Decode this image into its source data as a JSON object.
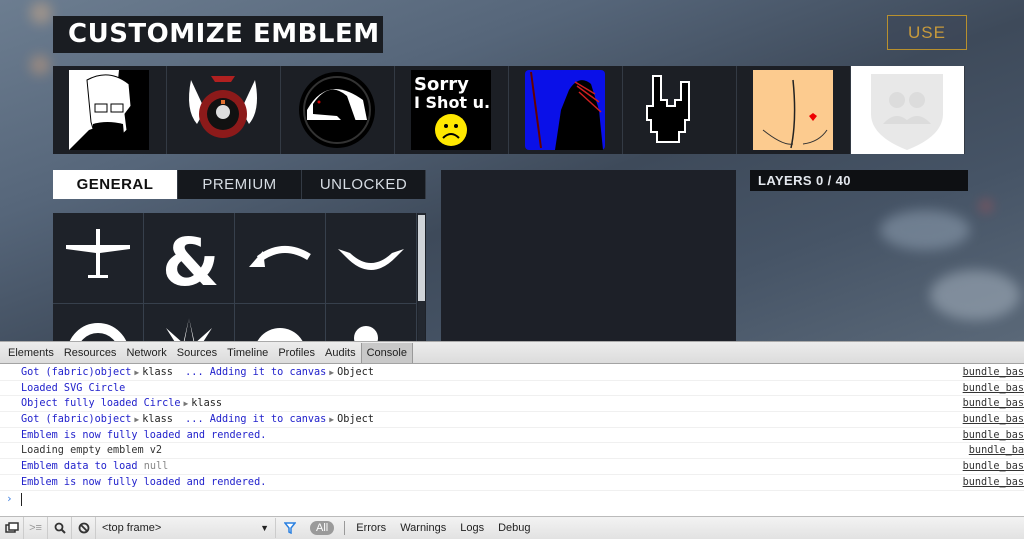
{
  "page": {
    "title": "CUSTOMIZE EMBLEM",
    "use_button": "USE",
    "accent_color": "#c79a3c"
  },
  "emblems": [
    {
      "name": "heisenberg-emblem",
      "selected": false
    },
    {
      "name": "winged-skull-emblem",
      "selected": false
    },
    {
      "name": "raven-emblem",
      "selected": false
    },
    {
      "name": "sorry-i-shot-u-emblem",
      "text_line1": "Sorry",
      "text_line2": "I Shot u.",
      "selected": false
    },
    {
      "name": "tribal-warrior-emblem",
      "selected": false
    },
    {
      "name": "rock-hand-emblem",
      "selected": false
    },
    {
      "name": "heart-butt-emblem",
      "selected": false
    },
    {
      "name": "empty-squad-emblem",
      "selected": true
    }
  ],
  "tabs": [
    {
      "label": "GENERAL",
      "active": true
    },
    {
      "label": "PREMIUM",
      "active": false
    },
    {
      "label": "UNLOCKED",
      "active": false
    }
  ],
  "shapes": [
    "airplane",
    "ampersand",
    "curved-arrow",
    "banner-ribbon",
    "lifebuoy",
    "starburst",
    "half-circle",
    "dot"
  ],
  "layers": {
    "label": "LAYERS 0 / 40"
  },
  "devtools": {
    "tabs": [
      "Elements",
      "Resources",
      "Network",
      "Sources",
      "Timeline",
      "Profiles",
      "Audits",
      "Console"
    ],
    "active_tab": "Console",
    "console": [
      {
        "msg": "Got (fabric)object",
        "obj1": "klass",
        "msg2": "  ... Adding it to canvas",
        "obj2": "Object",
        "source": "bundle_bas"
      },
      {
        "msg": "Loaded SVG Circle",
        "source": "bundle_bas"
      },
      {
        "msg": "Object fully loaded Circle",
        "obj1": "klass",
        "source": "bundle_bas"
      },
      {
        "msg": "Got (fabric)object",
        "obj1": "klass",
        "msg2": "  ... Adding it to canvas",
        "obj2": "Object",
        "source": "bundle_bas"
      },
      {
        "msg": "Emblem is now fully loaded and rendered.",
        "source": "bundle_bas"
      },
      {
        "msg": "Loading empty emblem v2",
        "source": "bundle_ba"
      },
      {
        "msg": "Emblem data to load",
        "value": "null",
        "source": "bundle_bas"
      },
      {
        "msg": "Emblem is now fully loaded and rendered.",
        "source": "bundle_bas"
      }
    ],
    "toolbar": {
      "frame": "<top frame>",
      "all": "All",
      "levels": [
        "Errors",
        "Warnings",
        "Logs",
        "Debug"
      ]
    }
  }
}
